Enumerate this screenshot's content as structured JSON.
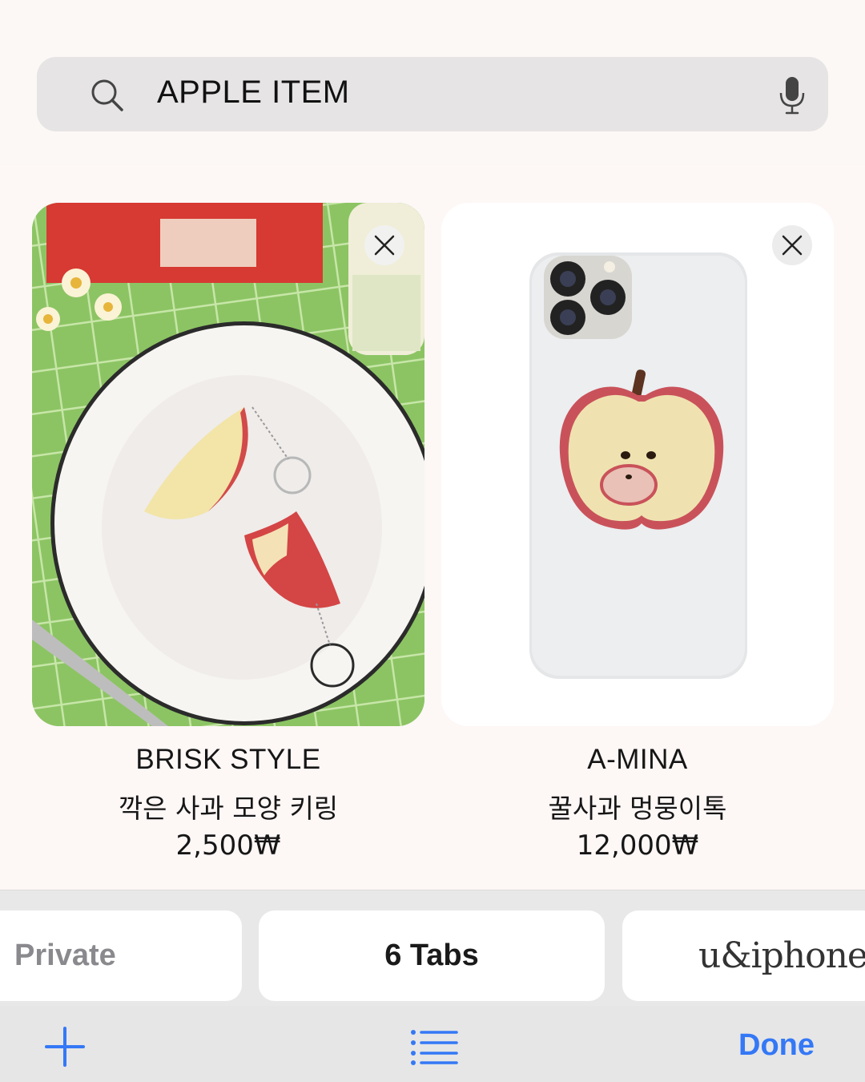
{
  "search": {
    "query": "APPLE ITEM"
  },
  "tabs": [
    {
      "title": "BRISK STYLE",
      "subtitle": "깍은 사과 모양 키링",
      "price": "2,500₩"
    },
    {
      "title": "A-MINA",
      "subtitle": "꿀사과 멍뭉이톡",
      "price": "12,000₩"
    }
  ],
  "tab_groups": {
    "private_label": "Private",
    "tabs_label": "6 Tabs",
    "brand_label": "u&iphone"
  },
  "toolbar": {
    "done_label": "Done"
  },
  "colors": {
    "accent": "#3478f6",
    "search_bg": "#e6e4e4",
    "selector_bg": "#e8e8e8"
  },
  "icons": [
    "search-icon",
    "microphone-icon",
    "close-icon",
    "plus-icon",
    "list-icon"
  ]
}
